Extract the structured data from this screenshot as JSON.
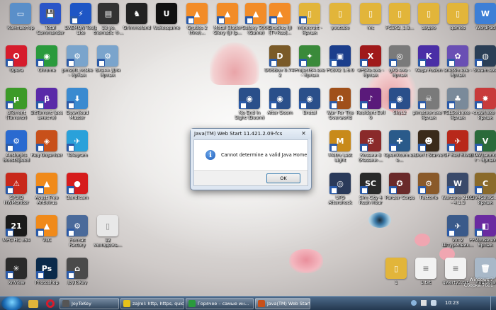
{
  "desktop_icons": [
    {
      "label": "Компьютер",
      "color": "#5a8fc9",
      "glyph": "▭",
      "arrow": false
    },
    {
      "label": "Total Commander",
      "color": "#2b55c8",
      "glyph": "💾",
      "arrow": false
    },
    {
      "label": "DAEMON Tools Lite",
      "color": "#1e56c5",
      "glyph": "⚡",
      "arrow": true
    },
    {
      "label": "18 yo. thematic ©...",
      "color": "#333333",
      "glyph": "▤",
      "arrow": false
    },
    {
      "label": "Grimmoland",
      "color": "#222222",
      "glyph": "♞",
      "arrow": false
    },
    {
      "label": "Nukesgame",
      "color": "#111111",
      "glyph": "U",
      "arrow": false
    },
    {
      "label": "Grudos 2 (fine)...",
      "color": "#f28c28",
      "glyph": "▲",
      "arrow": true
    },
    {
      "label": "Metal Slader Glory (J) (p...",
      "color": "#f28c28",
      "glyph": "▲",
      "arrow": true
    },
    {
      "label": "Galaxy 5000 (Game)",
      "color": "#f28c28",
      "glyph": "▲",
      "arrow": true
    },
    {
      "label": "Gradius (J) [T+Rus]...",
      "color": "#f28c28",
      "glyph": "▲",
      "arrow": true
    },
    {
      "label": "minecraft - Ярлык",
      "color": "#e2b53a",
      "glyph": "▯",
      "arrow": true
    },
    {
      "label": "youtube",
      "color": "#e2b53a",
      "glyph": "▯",
      "arrow": false
    },
    {
      "label": "mc",
      "color": "#e2b53a",
      "glyph": "▯",
      "arrow": false
    },
    {
      "label": "PCSX2_1.8...",
      "color": "#e2b53a",
      "glyph": "▯",
      "arrow": false
    },
    {
      "label": "видео",
      "color": "#e2b53a",
      "glyph": "▯",
      "arrow": false
    },
    {
      "label": "games",
      "color": "#e2b53a",
      "glyph": "▯",
      "arrow": false
    },
    {
      "label": "WordPad",
      "color": "#3d7fd6",
      "glyph": "W",
      "arrow": false
    },
    {
      "label": "Opera",
      "color": "#d61c2c",
      "glyph": "O",
      "arrow": true
    },
    {
      "label": "Chrome",
      "color": "#2a9a3c",
      "glyph": "◉",
      "arrow": true
    },
    {
      "label": "pmsoft_ncsbe - Ярлык",
      "color": "#7aa4cc",
      "glyph": "⚙",
      "arrow": true
    },
    {
      "label": "Бланк Для Ярлык",
      "color": "#7aa4cc",
      "glyph": "⚙",
      "arrow": true
    },
    {
      "label": "DOSBox 0.74-2",
      "color": "#7a5a28",
      "glyph": "D",
      "arrow": true
    },
    {
      "label": "Project64.exe - Ярлык",
      "color": "#3a8a3a",
      "glyph": "✦",
      "arrow": true
    },
    {
      "label": "PCSX2 1.6.0",
      "color": "#1b3e8c",
      "glyph": "▣",
      "arrow": true
    },
    {
      "label": "ePSXe.exe - Ярлык",
      "color": "#a0191a",
      "glyph": "X",
      "arrow": true
    },
    {
      "label": "gX2.exe - Ярлык",
      "color": "#7a7a7a",
      "glyph": "◎",
      "arrow": true
    },
    {
      "label": "Kega Fusion",
      "color": "#4a2ea6",
      "glyph": "K",
      "arrow": true
    },
    {
      "label": "snes9x.exe - Ярлык",
      "color": "#6a4fb4",
      "glyph": "✿",
      "arrow": true
    },
    {
      "label": "Steam.exe",
      "color": "#2a3e55",
      "glyph": "◍",
      "arrow": true
    },
    {
      "label": "uTorrent (Torrentr)",
      "color": "#3c9a28",
      "glyph": "μ",
      "arrow": true
    },
    {
      "label": "BitTorrent (все вместе)",
      "color": "#5a2aa8",
      "glyph": "β",
      "arrow": true
    },
    {
      "label": "Download Master",
      "color": "#3a8ad0",
      "glyph": "⬇",
      "arrow": true
    },
    {
      "label": "No End in Sight (Doom)",
      "color": "#2a4f8a",
      "glyph": "◉",
      "arrow": true
    },
    {
      "label": "After Doom",
      "color": "#2a4f8a",
      "glyph": "◉",
      "arrow": true
    },
    {
      "label": "Brutal",
      "color": "#2a4f8a",
      "glyph": "◉",
      "arrow": true
    },
    {
      "label": "War For The Overworld",
      "color": "#a0501a",
      "glyph": "Ω",
      "arrow": true
    },
    {
      "label": "Resident Evil 0",
      "color": "#5a1a7a",
      "glyph": "♪",
      "arrow": true
    },
    {
      "label": "SkyL2",
      "color": "#2a4f8a",
      "glyph": "◉",
      "arrow": true
    },
    {
      "label": "pimateer.exe - Ярлык",
      "color": "#7a7a7a",
      "glyph": "☠",
      "arrow": true
    },
    {
      "label": "TGLSoN.exe - Ярлык",
      "color": "#7a8a9a",
      "glyph": "♣",
      "arrow": true
    },
    {
      "label": "crawl.exe - Ярлык",
      "color": "#c83a3a",
      "glyph": "✸",
      "arrow": true
    },
    {
      "label": "Auslogics BoostSpeed",
      "color": "#2a6ad0",
      "glyph": "⚙",
      "arrow": true
    },
    {
      "label": "Reg Organizer",
      "color": "#c8501a",
      "glyph": "◈",
      "arrow": true
    },
    {
      "label": "Telegram",
      "color": "#2aa1da",
      "glyph": "✈",
      "arrow": true
    },
    {
      "label": "Metro Last Light",
      "color": "#c88a1a",
      "glyph": "M",
      "arrow": true
    },
    {
      "label": "Козаки-3 (Казаки-...",
      "color": "#8a2a2a",
      "glyph": "✠",
      "arrow": true
    },
    {
      "label": "OpenXcom.exe...",
      "color": "#2a5a8a",
      "glyph": "✚",
      "arrow": true
    },
    {
      "label": "Don't Starve",
      "color": "#3a2a1a",
      "glyph": "☻",
      "arrow": true
    },
    {
      "label": "OF Red River",
      "color": "#b8281a",
      "glyph": "✈",
      "arrow": true
    },
    {
      "label": "GTAV.Launcher - Ярлык",
      "color": "#2a6a3a",
      "glyph": "V",
      "arrow": true
    },
    {
      "label": "CPUID HWMonitor",
      "color": "#c8281a",
      "glyph": "⚠",
      "arrow": true
    },
    {
      "label": "Avast Free Antivirus",
      "color": "#f08a1a",
      "glyph": "▲",
      "arrow": true
    },
    {
      "label": "Bandicam",
      "color": "#d61c1c",
      "glyph": "●",
      "arrow": true
    },
    {
      "label": "UFO Aftershock",
      "color": "#2a3a5a",
      "glyph": "◎",
      "arrow": true
    },
    {
      "label": "Sim City 4 Rush Hour",
      "color": "#2a2a2a",
      "glyph": "SC",
      "arrow": true
    },
    {
      "label": "Panzer Corps",
      "color": "#6a2a2a",
      "glyph": "✪",
      "arrow": true
    },
    {
      "label": "Factorio",
      "color": "#8a5a2a",
      "glyph": "⚙",
      "arrow": true
    },
    {
      "label": "Warzone 2100 - 4.1.3",
      "color": "#3a4a6a",
      "glyph": "W",
      "arrow": true
    },
    {
      "label": "CIV4ColaC... - Ярлык",
      "color": "#8a6a2a",
      "glyph": "C",
      "arrow": true
    },
    {
      "label": "MPC-HC x64",
      "color": "#1a1a1a",
      "glyph": "21",
      "arrow": true
    },
    {
      "label": "VLC",
      "color": "#f08a1a",
      "glyph": "▲",
      "arrow": true
    },
    {
      "label": "Format Factory",
      "color": "#4a6a9a",
      "glyph": "⚙",
      "arrow": true
    },
    {
      "label": "12 молодежь...",
      "color": "#e8e8e8",
      "glyph": "▯",
      "arrow": false
    },
    {
      "label": "Ил-2 Штурмовик...",
      "color": "#3a5a8a",
      "glyph": "✈",
      "arrow": true
    },
    {
      "label": "PPMouse.exe - Ярлык",
      "color": "#6a2aa0",
      "glyph": "◧",
      "arrow": true
    },
    {
      "label": "XnView",
      "color": "#2a2a2a",
      "glyph": "✳",
      "arrow": true
    },
    {
      "label": "Photoshop",
      "color": "#0b2a4a",
      "glyph": "Ps",
      "arrow": true
    },
    {
      "label": "JoyToKey",
      "color": "#4a4a4a",
      "glyph": "⌂",
      "arrow": true
    },
    {
      "label": "1",
      "color": "#e2b53a",
      "glyph": "▯",
      "arrow": false
    },
    {
      "label": "1.txt",
      "color": "#f2f2f2",
      "glyph": "≡",
      "arrow": false
    },
    {
      "label": "qwerty3.txt",
      "color": "#f2f2f2",
      "glyph": "≡",
      "arrow": false
    },
    {
      "label": "Корзина",
      "color": "#a8b8c8",
      "glyph": "🗑",
      "arrow": false
    }
  ],
  "dialog": {
    "title": "Java(TM) Web Start 11.421.2.09-fcs",
    "close": "✕",
    "info_glyph": "i",
    "message": "Cannot determine a valid Java Home",
    "ok": "OK"
  },
  "taskbar": {
    "buttons": [
      {
        "label": "JoyToKey",
        "color": "#555555"
      },
      {
        "label": "zajrel: http, https, quic",
        "color": "#e6c21a"
      },
      {
        "label": "Горячее – самые ин...",
        "color": "#2a9a3c"
      },
      {
        "label": "Java(TM) Web Start 11...",
        "color": "#c8501a"
      }
    ],
    "clock": "10:23",
    "watermark_line1": "Windows 7",
    "watermark_line2": "Сборка 7601"
  }
}
